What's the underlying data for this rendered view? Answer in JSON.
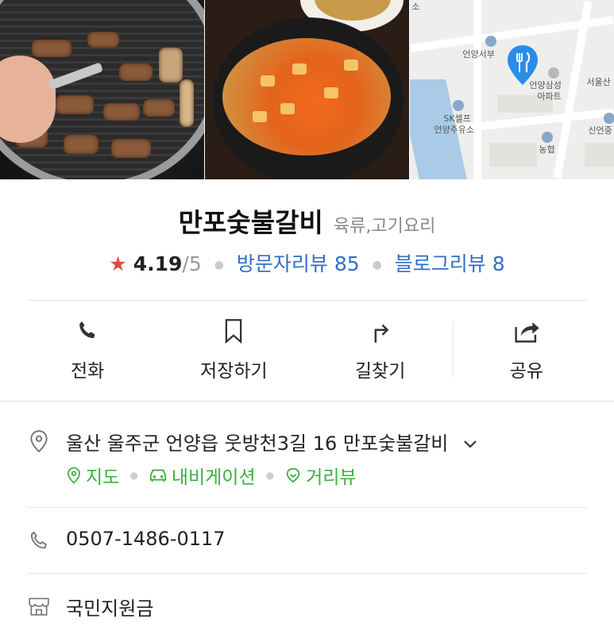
{
  "place": {
    "name": "만포숯불갈비",
    "category": "육류,고기요리",
    "rating": {
      "star": "★",
      "score": "4.19",
      "out_of": "/5",
      "visitor_reviews_label": "방문자리뷰 85",
      "blog_reviews_label": "블로그리뷰 8"
    }
  },
  "map": {
    "labels": {
      "top_partial": "소",
      "eonyang_west": "언양서부",
      "eonyang_samsung": "언양삼성",
      "apartment": "아파트",
      "seoul_partial": "서울산",
      "sk_self": "SK셀프",
      "eonyang_gas": "언양주유소",
      "sineon_partial": "신언중",
      "nonghyup": "농협"
    }
  },
  "actions": [
    {
      "label": "전화",
      "icon": "phone-icon"
    },
    {
      "label": "저장하기",
      "icon": "bookmark-icon"
    },
    {
      "label": "길찾기",
      "icon": "directions-icon"
    },
    {
      "label": "공유",
      "icon": "share-icon"
    }
  ],
  "info": {
    "address": "울산 울주군 언양읍 웃방천3길 16 만포숯불갈비",
    "links": {
      "map": "지도",
      "navigation": "내비게이션",
      "street_view": "거리뷰"
    },
    "phone": "0507-1486-0117",
    "support_fund": "국민지원금"
  },
  "colors": {
    "star": "#e04b3c",
    "link_blue": "#2f6fc6",
    "link_green": "#3bb03b",
    "map_pin": "#2a8de9"
  }
}
